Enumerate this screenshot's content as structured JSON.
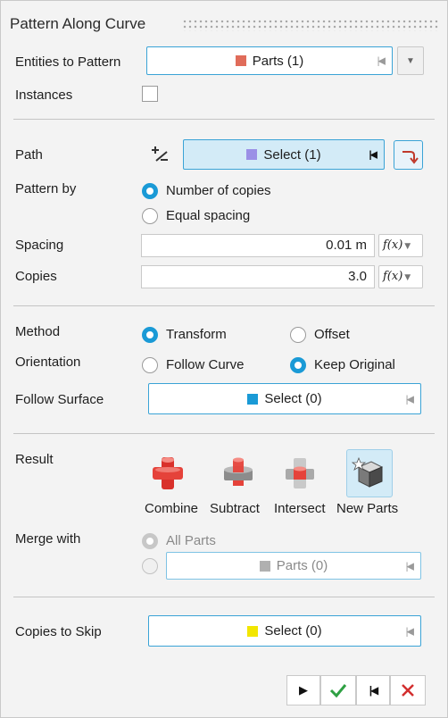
{
  "panel": {
    "title": "Pattern Along Curve"
  },
  "entities": {
    "label": "Entities to Pattern",
    "value": "Parts (1)",
    "swatch_color": "#e06c5a"
  },
  "instances": {
    "label": "Instances",
    "checked": false
  },
  "path": {
    "label": "Path",
    "value": "Select (1)",
    "swatch_color": "#9b8fe6"
  },
  "pattern_by": {
    "label": "Pattern by",
    "options": [
      "Number of copies",
      "Equal spacing"
    ],
    "selected": "Number of copies"
  },
  "spacing": {
    "label": "Spacing",
    "value": "0.01 m"
  },
  "copies": {
    "label": "Copies",
    "value": "3.0"
  },
  "method": {
    "label": "Method",
    "options": [
      "Transform",
      "Offset"
    ],
    "selected": "Transform"
  },
  "orientation": {
    "label": "Orientation",
    "options": [
      "Follow Curve",
      "Keep Original"
    ],
    "selected": "Keep Original"
  },
  "follow_surface": {
    "label": "Follow Surface",
    "value": "Select (0)",
    "swatch_color": "#1a9ad6"
  },
  "result": {
    "label": "Result",
    "options": [
      "Combine",
      "Subtract",
      "Intersect",
      "New Parts"
    ],
    "selected": "New Parts"
  },
  "merge_with": {
    "label": "Merge with",
    "all_parts_label": "All Parts",
    "parts_value": "Parts (0)",
    "swatch_color": "#b0b0b0"
  },
  "copies_to_skip": {
    "label": "Copies to Skip",
    "value": "Select (0)",
    "swatch_color": "#f2e600"
  },
  "fx_symbol": "f(x)",
  "colors": {
    "accent": "#1a9ad6",
    "ok": "#2ea043",
    "cancel": "#d32f2f"
  }
}
